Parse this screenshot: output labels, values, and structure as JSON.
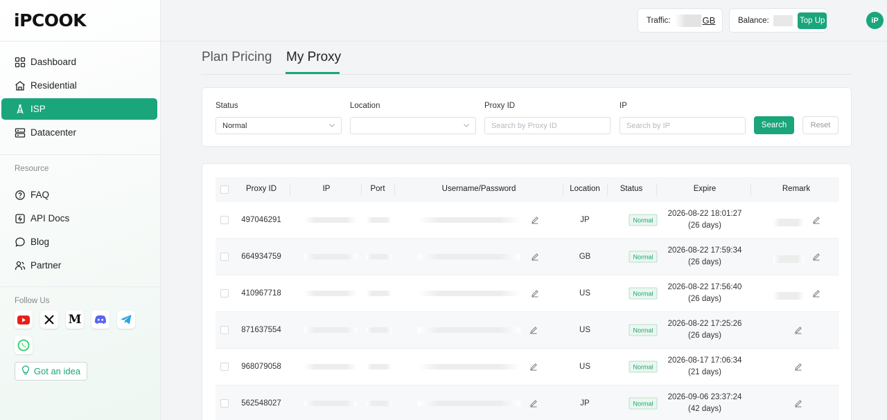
{
  "app": {
    "logo_text": "iPCOOK",
    "avatar_text": "iP"
  },
  "nav": {
    "items": [
      {
        "label": "Dashboard",
        "icon": "dashboard-icon"
      },
      {
        "label": "Residential",
        "icon": "residential-icon"
      },
      {
        "label": "ISP",
        "icon": "isp-icon",
        "active": true
      },
      {
        "label": "Datacenter",
        "icon": "datacenter-icon"
      }
    ],
    "resource_label": "Resource",
    "resources": [
      {
        "label": "FAQ",
        "icon": "faq-icon"
      },
      {
        "label": "API Docs",
        "icon": "api-docs-icon"
      },
      {
        "label": "Blog",
        "icon": "blog-icon"
      },
      {
        "label": "Partner",
        "icon": "partner-icon"
      }
    ],
    "follow_label": "Follow Us",
    "social": [
      "youtube-icon",
      "x-icon",
      "medium-icon",
      "discord-icon",
      "telegram-icon",
      "whatsapp-icon"
    ],
    "idea_label": "Got an idea"
  },
  "topbar": {
    "traffic_label": "Traffic:",
    "traffic_unit": "GB",
    "balance_label": "Balance:",
    "topup_label": "Top Up"
  },
  "tabs": [
    {
      "label": "Plan Pricing",
      "active": false
    },
    {
      "label": "My Proxy",
      "active": true
    }
  ],
  "filters": {
    "status_label": "Status",
    "status_value": "Normal",
    "location_label": "Location",
    "location_value": "",
    "proxy_id_label": "Proxy ID",
    "proxy_id_placeholder": "Search by Proxy ID",
    "ip_label": "IP",
    "ip_placeholder": "Search by IP",
    "search_label": "Search",
    "reset_label": "Reset"
  },
  "table": {
    "columns": [
      "Proxy ID",
      "IP",
      "Port",
      "Username/Password",
      "Location",
      "Status",
      "Expire",
      "Remark"
    ],
    "rows": [
      {
        "proxy_id": "497046291",
        "location": "JP",
        "status": "Normal",
        "expire": "2026-08-22 18:01:27",
        "days": "(26 days)",
        "has_remark": true
      },
      {
        "proxy_id": "664934759",
        "location": "GB",
        "status": "Normal",
        "expire": "2026-08-22 17:59:34",
        "days": "(26 days)",
        "has_remark": true
      },
      {
        "proxy_id": "410967718",
        "location": "US",
        "status": "Normal",
        "expire": "2026-08-22 17:56:40",
        "days": "(26 days)",
        "has_remark": true
      },
      {
        "proxy_id": "871637554",
        "location": "US",
        "status": "Normal",
        "expire": "2026-08-22 17:25:26",
        "days": "(26 days)",
        "has_remark": false
      },
      {
        "proxy_id": "968079058",
        "location": "US",
        "status": "Normal",
        "expire": "2026-08-17 17:06:34",
        "days": "(21 days)",
        "has_remark": false
      },
      {
        "proxy_id": "562548027",
        "location": "JP",
        "status": "Normal",
        "expire": "2026-09-06 23:37:24",
        "days": "(42 days)",
        "has_remark": false
      }
    ]
  },
  "colors": {
    "accent": "#1aa57b",
    "badge_bg": "#eaf7ef"
  }
}
